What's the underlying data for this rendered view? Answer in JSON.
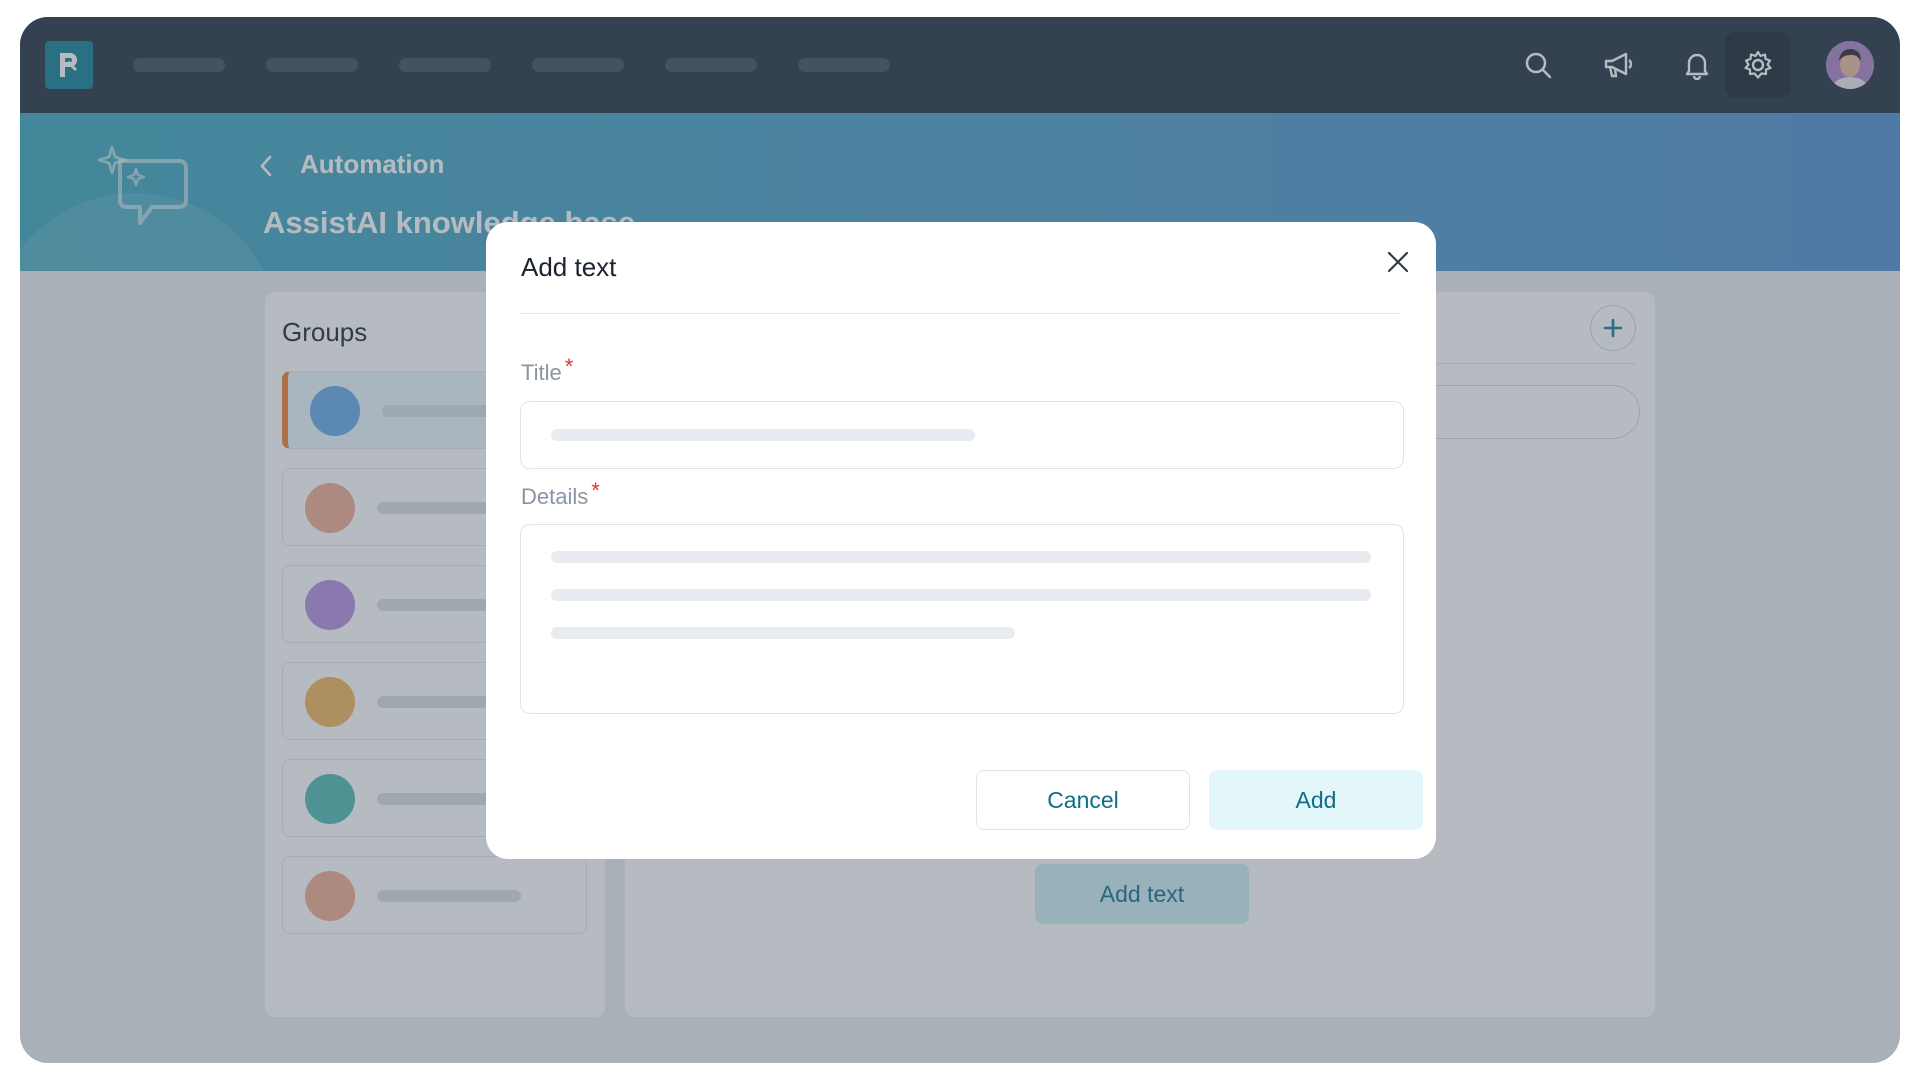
{
  "colors": {
    "nav_bg": "#1f2d3f",
    "brand_teal": "#0f7f95",
    "accent_orange": "#ee7d2f",
    "required_red": "#d6343c"
  },
  "topnav": {
    "icons": [
      "search-icon",
      "megaphone-icon",
      "bell-icon",
      "gear-icon"
    ]
  },
  "header": {
    "breadcrumb": "Automation",
    "title": "AssistAI knowledge base"
  },
  "groups": {
    "title": "Groups",
    "items": [
      {
        "color": "#62a9e8",
        "active": true
      },
      {
        "color": "#f2a98f"
      },
      {
        "color": "#b48ee0"
      },
      {
        "color": "#f0b458"
      },
      {
        "color": "#4eb9b1"
      },
      {
        "color": "#f2a98f"
      }
    ]
  },
  "content": {
    "add_text_label": "Add text"
  },
  "modal": {
    "title": "Add text",
    "title_field_label": "Title",
    "details_field_label": "Details",
    "required_mark": "*",
    "cancel_label": "Cancel",
    "add_label": "Add"
  }
}
